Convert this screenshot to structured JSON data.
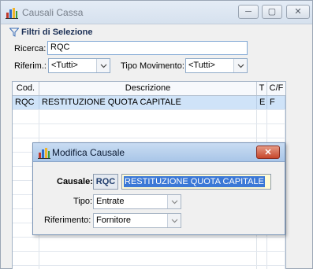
{
  "main_window": {
    "title": "Causali Cassa",
    "minimize_glyph": "─",
    "maximize_glyph": "▢",
    "close_glyph": "✕"
  },
  "filters": {
    "header": "Filtri di Selezione",
    "search_label": "Ricerca:",
    "search_value": "RQC",
    "riferim_label": "Riferim.:",
    "riferim_value": "<Tutti>",
    "tipo_movimento_label": "Tipo Movimento:",
    "tipo_movimento_value": "<Tutti>"
  },
  "grid": {
    "columns": [
      "Cod.",
      "Descrizione",
      "T",
      "C/F"
    ],
    "rows": [
      {
        "cod": "RQC",
        "descrizione": "RESTITUZIONE QUOTA CAPITALE",
        "t": "E",
        "cf": "F",
        "selected": true
      }
    ]
  },
  "dialog": {
    "title": "Modifica Causale",
    "close_glyph": "✕",
    "causale_label": "Causale:",
    "causale_code": "RQC",
    "causale_description": "RESTITUZIONE QUOTA CAPITALE",
    "tipo_label": "Tipo:",
    "tipo_value": "Entrate",
    "riferimento_label": "Riferimento:",
    "riferimento_value": "Fornitore"
  },
  "icons": {
    "app": "bar-chart-icon",
    "filter": "funnel-icon",
    "dropdown": "chevron-down-icon"
  },
  "colors": {
    "accent": "#3b78d6",
    "selected_row": "#cfe3f8",
    "close_button": "#c7472b",
    "description_field": "#fffbd6"
  }
}
